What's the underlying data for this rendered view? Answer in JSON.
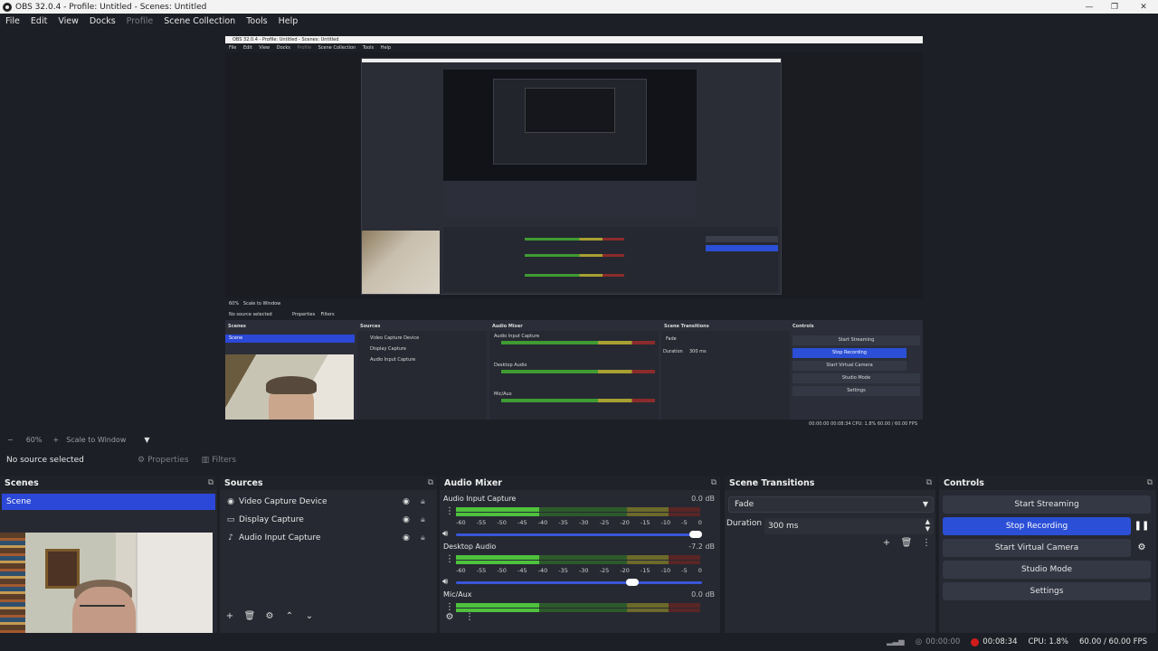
{
  "window": {
    "title": "OBS 32.0.4 - Profile: Untitled - Scenes: Untitled"
  },
  "menu": [
    "File",
    "Edit",
    "View",
    "Docks",
    "Profile",
    "Scene Collection",
    "Tools",
    "Help"
  ],
  "nested_preview": {
    "title": "OBS 32.0.4 - Profile: Untitled - Scenes: Untitled",
    "menu": [
      "File",
      "Edit",
      "View",
      "Docks",
      "Profile",
      "Scene Collection",
      "Tools",
      "Help"
    ],
    "no_source": "No source selected",
    "properties": "Properties",
    "filters": "Filters",
    "scenes_title": "Scenes",
    "sources_title": "Sources",
    "mixer_title": "Audio Mixer",
    "transitions_title": "Scene Transitions",
    "controls_title": "Controls",
    "scene": "Scene",
    "sources": [
      "Video Capture Device",
      "Display Capture",
      "Audio Input Capture"
    ],
    "channels": [
      "Audio Input Capture",
      "Desktop Audio",
      "Mic/Aux"
    ],
    "fade": "Fade",
    "duration": "Duration",
    "duration_value": "300 ms",
    "buttons": [
      "Start Streaming",
      "Stop Recording",
      "Start Virtual Camera",
      "Studio Mode",
      "Settings"
    ],
    "zoom": "60%",
    "scale": "Scale to Window",
    "status": "00:00:00   00:08:34   CPU: 1.8%   60.00 / 60.00 FPS"
  },
  "zoom_bar": {
    "zoom": "60%",
    "scale_mode": "Scale to Window"
  },
  "props_bar": {
    "no_source": "No source selected",
    "properties_label": "Properties",
    "filters_label": "Filters"
  },
  "scenes": {
    "title": "Scenes",
    "items": [
      "Scene"
    ]
  },
  "sources": {
    "title": "Sources",
    "items": [
      {
        "name": "Video Capture Device",
        "icon": "camera-icon"
      },
      {
        "name": "Display Capture",
        "icon": "monitor-icon"
      },
      {
        "name": "Audio Input Capture",
        "icon": "microphone-icon"
      }
    ]
  },
  "mixer": {
    "title": "Audio Mixer",
    "scale": [
      "-60",
      "-55",
      "-50",
      "-45",
      "-40",
      "-35",
      "-30",
      "-25",
      "-20",
      "-15",
      "-10",
      "-5",
      "0"
    ],
    "channels": [
      {
        "name": "Audio Input Capture",
        "db": "0.0 dB",
        "volume": 1.0
      },
      {
        "name": "Desktop Audio",
        "db": "-7.2 dB",
        "volume": 0.73
      },
      {
        "name": "Mic/Aux",
        "db": "0.0 dB",
        "volume": 1.0
      }
    ]
  },
  "transitions": {
    "title": "Scene Transitions",
    "selected": "Fade",
    "duration_label": "Duration",
    "duration_value": "300 ms"
  },
  "controls": {
    "title": "Controls",
    "start_streaming": "Start Streaming",
    "stop_recording": "Stop Recording",
    "start_virtual_camera": "Start Virtual Camera",
    "studio_mode": "Studio Mode",
    "settings": "Settings"
  },
  "status": {
    "stream_time": "00:00:00",
    "rec_time": "00:08:34",
    "cpu": "CPU: 1.8%",
    "fps": "60.00 / 60.00 FPS"
  },
  "colors": {
    "accent": "#2b4fd6",
    "selection": "#2c48d8",
    "record": "#d11c1c",
    "meter_green": "#3f9b32",
    "meter_yellow": "#a8a032",
    "meter_red": "#8b2b2b"
  }
}
